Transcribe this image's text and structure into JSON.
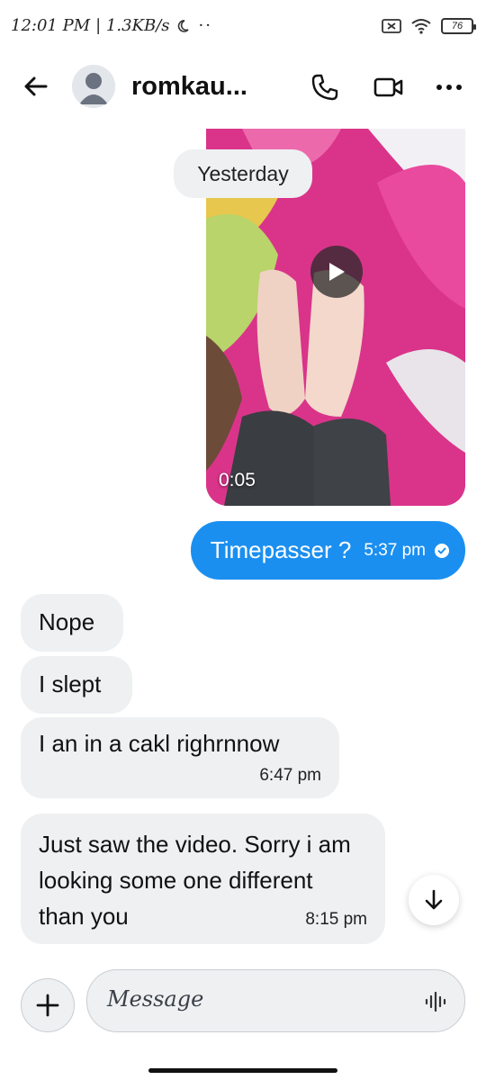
{
  "status_bar": {
    "time": "12:01 PM",
    "speed": "| 1.3KB/s",
    "extra": "··",
    "battery": "76"
  },
  "header": {
    "contact_name": "romkau..."
  },
  "conversation": {
    "date_separator": "Yesterday",
    "video": {
      "duration": "0:05"
    },
    "outgoing": [
      {
        "text": "Timepasser ?",
        "time": "5:37 pm"
      }
    ],
    "incoming": [
      {
        "text": "Nope",
        "time": ""
      },
      {
        "text": "I slept",
        "time": ""
      },
      {
        "text": "I an in a cakl righrnnow",
        "time": "6:47 pm"
      },
      {
        "text": "Just saw the video. Sorry i am looking some one different than you",
        "time": "8:15 pm"
      }
    ]
  },
  "composer": {
    "placeholder": "Message"
  },
  "colors": {
    "outgoing_bubble": "#1b8ff0",
    "incoming_bubble": "#eef0f2"
  }
}
